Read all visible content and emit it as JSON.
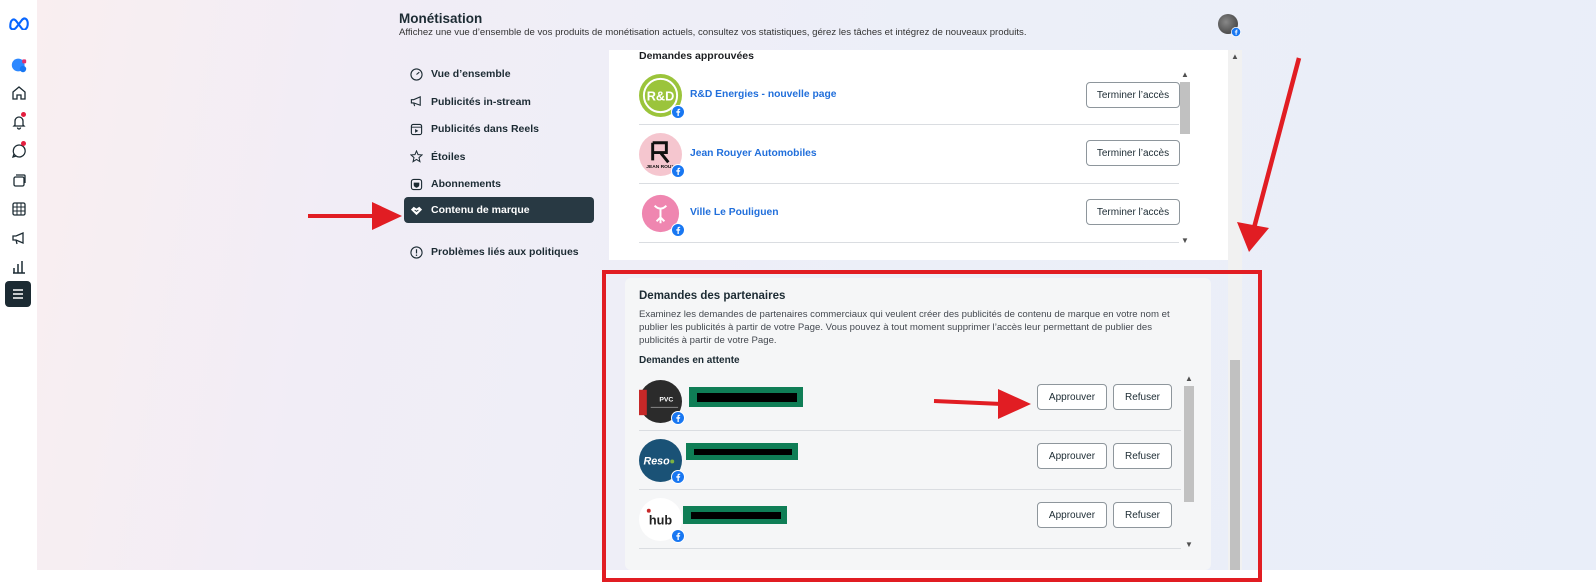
{
  "header": {
    "title": "Monétisation",
    "subtitle": "Affichez une vue d’ensemble de vos produits de monétisation actuels, consultez vos statistiques, gérez les tâches et intégrez de nouveaux produits."
  },
  "nav": {
    "items": [
      {
        "label": "Vue d’ensemble",
        "icon": "gauge-icon"
      },
      {
        "label": "Publicités in-stream",
        "icon": "megaphone-icon"
      },
      {
        "label": "Publicités dans Reels",
        "icon": "reels-icon"
      },
      {
        "label": "Étoiles",
        "icon": "star-icon"
      },
      {
        "label": "Abonnements",
        "icon": "badge-icon"
      },
      {
        "label": "Contenu de marque",
        "icon": "handshake-icon"
      },
      {
        "label": "Problèmes liés aux politiques",
        "icon": "alert-icon"
      }
    ],
    "active_index": 5
  },
  "approved": {
    "heading": "Demandes approuvées",
    "rows": [
      {
        "name": "R&D Energies - nouvelle page",
        "button": "Terminer l’accès"
      },
      {
        "name": "Jean Rouyer Automobiles",
        "button": "Terminer l’accès"
      },
      {
        "name": "Ville Le Pouliguen",
        "button": "Terminer l’accès"
      }
    ]
  },
  "partners": {
    "title": "Demandes des partenaires",
    "description": "Examinez les demandes de partenaires commerciaux qui veulent créer des publicités de contenu de marque en votre nom et publier les publicités à partir de votre Page. Vous pouvez à tout moment supprimer l’accès leur permettant de publier des publicités à partir de votre Page.",
    "subheading": "Demandes en attente",
    "approve_label": "Approuver",
    "refuse_label": "Refuser"
  },
  "logos": {
    "rd": "R&D",
    "jr": "JEAN ROUY",
    "pvc": "PVC",
    "reso": "Reso",
    "hub": "hub"
  },
  "colors": {
    "accent_red": "#e11d23",
    "active_nav": "#283943",
    "link_blue": "#216fdb",
    "meta_blue": "#0866ff"
  }
}
